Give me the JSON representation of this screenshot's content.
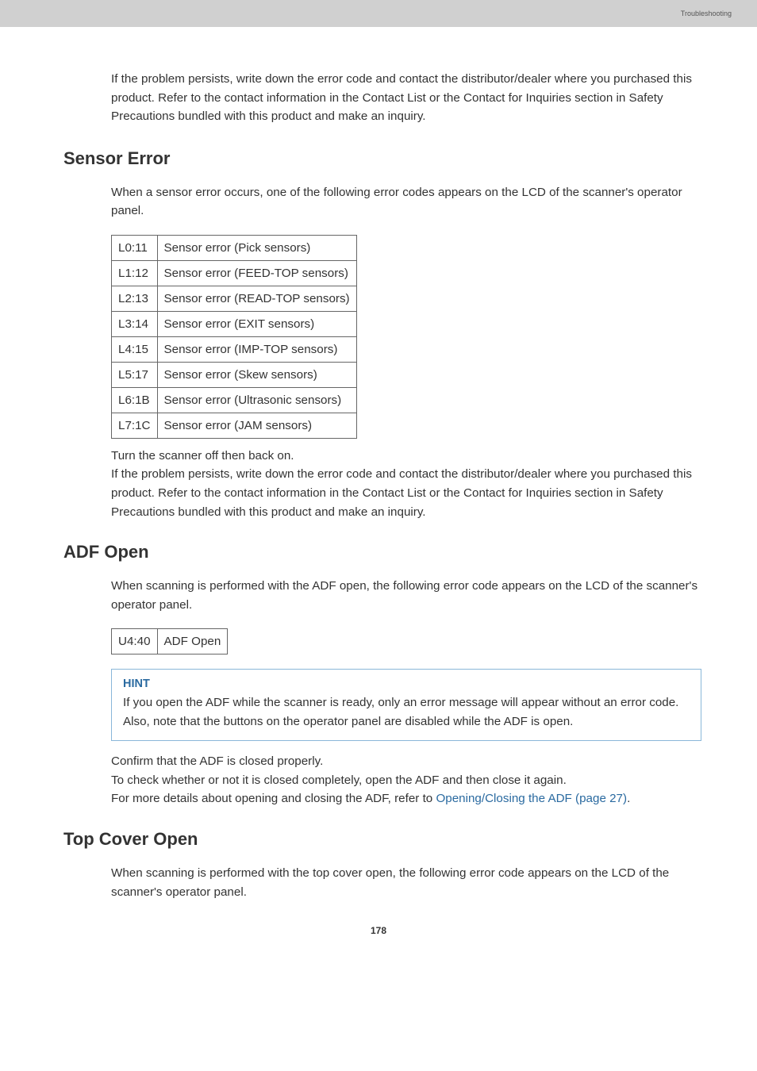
{
  "header": {
    "category": "Troubleshooting"
  },
  "lead_para": "If the problem persists, write down the error code and contact the distributor/dealer where you purchased this product. Refer to the contact information in the Contact List or the Contact for Inquiries section in Safety Precautions bundled with this product and make an inquiry.",
  "section_sensor": {
    "title": "Sensor Error",
    "intro": "When a sensor error occurs, one of the following error codes appears on the LCD of the scanner's operator panel.",
    "rows": [
      {
        "code": "L0:11",
        "desc": "Sensor error (Pick sensors)"
      },
      {
        "code": "L1:12",
        "desc": "Sensor error (FEED-TOP sensors)"
      },
      {
        "code": "L2:13",
        "desc": "Sensor error (READ-TOP sensors)"
      },
      {
        "code": "L3:14",
        "desc": "Sensor error (EXIT sensors)"
      },
      {
        "code": "L4:15",
        "desc": "Sensor error (IMP-TOP sensors)"
      },
      {
        "code": "L5:17",
        "desc": "Sensor error (Skew sensors)"
      },
      {
        "code": "L6:1B",
        "desc": "Sensor error (Ultrasonic sensors)"
      },
      {
        "code": "L7:1C",
        "desc": "Sensor error (JAM sensors)"
      }
    ],
    "after_line1": "Turn the scanner off then back on.",
    "after_line2": "If the problem persists, write down the error code and contact the distributor/dealer where you purchased this product. Refer to the contact information in the Contact List or the Contact for Inquiries section in Safety Precautions bundled with this product and make an inquiry."
  },
  "section_adf": {
    "title": "ADF Open",
    "intro": "When scanning is performed with the ADF open, the following error code appears on the LCD of the scanner's operator panel.",
    "rows": [
      {
        "code": "U4:40",
        "desc": "ADF Open"
      }
    ],
    "hint": {
      "title": "HINT",
      "body1": "If you open the ADF while the scanner is ready, only an error message will appear without an error code.",
      "body2": "Also, note that the buttons on the operator panel are disabled while the ADF is open."
    },
    "after_line1": "Confirm that the ADF is closed properly.",
    "after_line2": "To check whether or not it is closed completely, open the ADF and then close it again.",
    "after_line3_prefix": "For more details about opening and closing the ADF, refer to ",
    "after_line3_link": "Opening/Closing the ADF (page 27)",
    "after_line3_suffix": "."
  },
  "section_top": {
    "title": "Top Cover Open",
    "intro": "When scanning is performed with the top cover open, the following error code appears on the LCD of the scanner's operator panel."
  },
  "page_number": "178"
}
